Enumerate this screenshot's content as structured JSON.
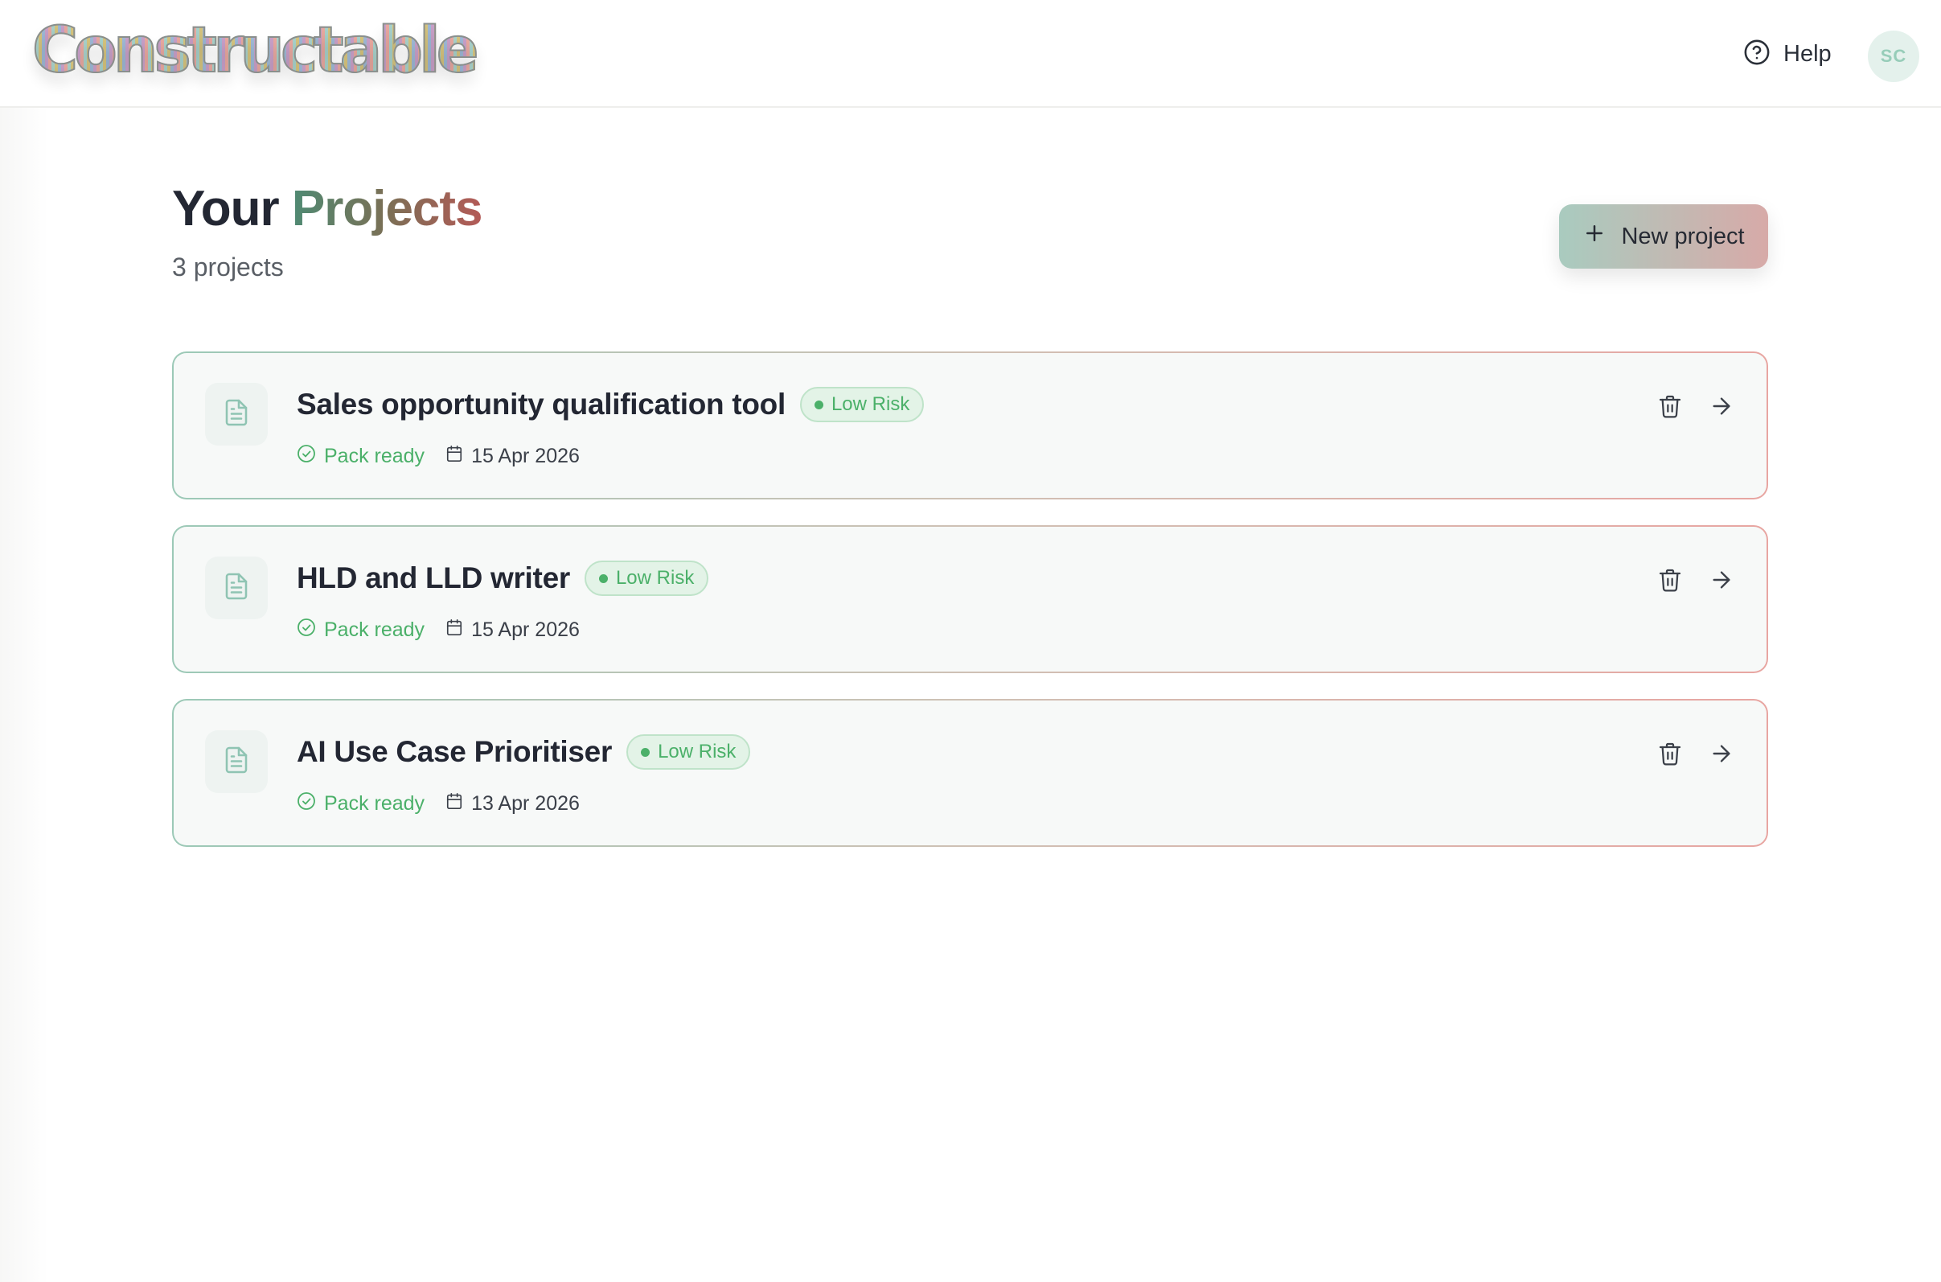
{
  "header": {
    "logo_text": "Constructable",
    "help_label": "Help",
    "avatar_initials": "SC"
  },
  "page": {
    "title_part1": "Your",
    "title_part2": "Projects",
    "project_count": "3 projects",
    "new_project_label": "New project"
  },
  "projects": [
    {
      "title": "Sales opportunity qualification tool",
      "risk": "Low Risk",
      "status": "Pack ready",
      "date": "15 Apr 2026"
    },
    {
      "title": "HLD and LLD writer",
      "risk": "Low Risk",
      "status": "Pack ready",
      "date": "15 Apr 2026"
    },
    {
      "title": "AI Use Case Prioritiser",
      "risk": "Low Risk",
      "status": "Pack ready",
      "date": "13 Apr 2026"
    }
  ],
  "colors": {
    "accent_green": "#4bb069",
    "title_gradient_start": "#4f8a73",
    "title_gradient_end": "#b45a57",
    "button_gradient_start": "#a9cbbf",
    "button_gradient_end": "#d7aaa8"
  },
  "icons": {
    "help": "help-circle-icon",
    "new_project": "plus-icon",
    "project": "document-icon",
    "status": "check-circle-icon",
    "date": "calendar-icon",
    "delete": "trash-icon",
    "open": "arrow-right-icon"
  }
}
